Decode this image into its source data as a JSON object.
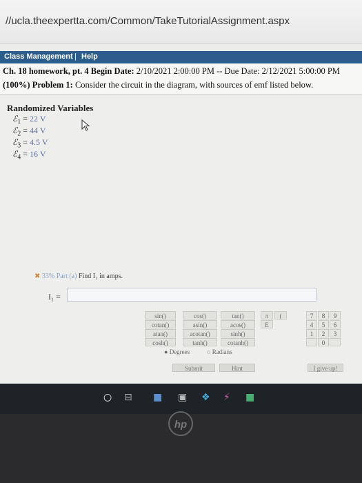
{
  "browser": {
    "url": "//ucla.theexpertta.com/Common/TakeTutorialAssignment.aspx"
  },
  "menubar": {
    "class_mgmt": "Class Management",
    "sep": "|",
    "help": "Help"
  },
  "header": {
    "line1_bold": "Ch. 18 homework, pt. 4 Begin Date:",
    "line1_rest": " 2/10/2021 2:00:00 PM -- Due Date: 2/12/2021 5:00:00 PM",
    "line2_bold": "(100%) Problem 1:",
    "line2_rest": " Consider the circuit in the diagram, with sources of emf listed below."
  },
  "randomized": {
    "title": "Randomized Variables",
    "vars": [
      {
        "sym": "ℰ",
        "sub": "1",
        "eq": " = ",
        "val": "22 V"
      },
      {
        "sym": "ℰ",
        "sub": "2",
        "eq": " = ",
        "val": "44 V"
      },
      {
        "sym": "ℰ",
        "sub": "3",
        "eq": " = ",
        "val": "4.5 V"
      },
      {
        "sym": "ℰ",
        "sub": "4",
        "eq": " = ",
        "val": "16 V"
      }
    ]
  },
  "part": {
    "percent": "33%",
    "label": "Part (a)",
    "prompt": "Find I₁ in amps."
  },
  "answer": {
    "label": "I₁ ="
  },
  "keypad": {
    "fn_rows": [
      [
        "sin()",
        "cos()",
        "tan()"
      ],
      [
        "cotan()",
        "asin()",
        "acos()"
      ],
      [
        "atan()",
        "acotan()",
        "sinh()"
      ],
      [
        "cosh()",
        "tanh()",
        "cotanh()"
      ]
    ],
    "consts": [
      "π",
      "(",
      "E"
    ],
    "nums": [
      [
        "7",
        "8",
        "9"
      ],
      [
        "4",
        "5",
        "6"
      ],
      [
        "1",
        "2",
        "3"
      ],
      [
        "",
        "0",
        ""
      ]
    ],
    "degrees": "Degrees",
    "radians": "Radians",
    "submit": "Submit",
    "hint": "Hint",
    "giveup": "I give up!"
  }
}
